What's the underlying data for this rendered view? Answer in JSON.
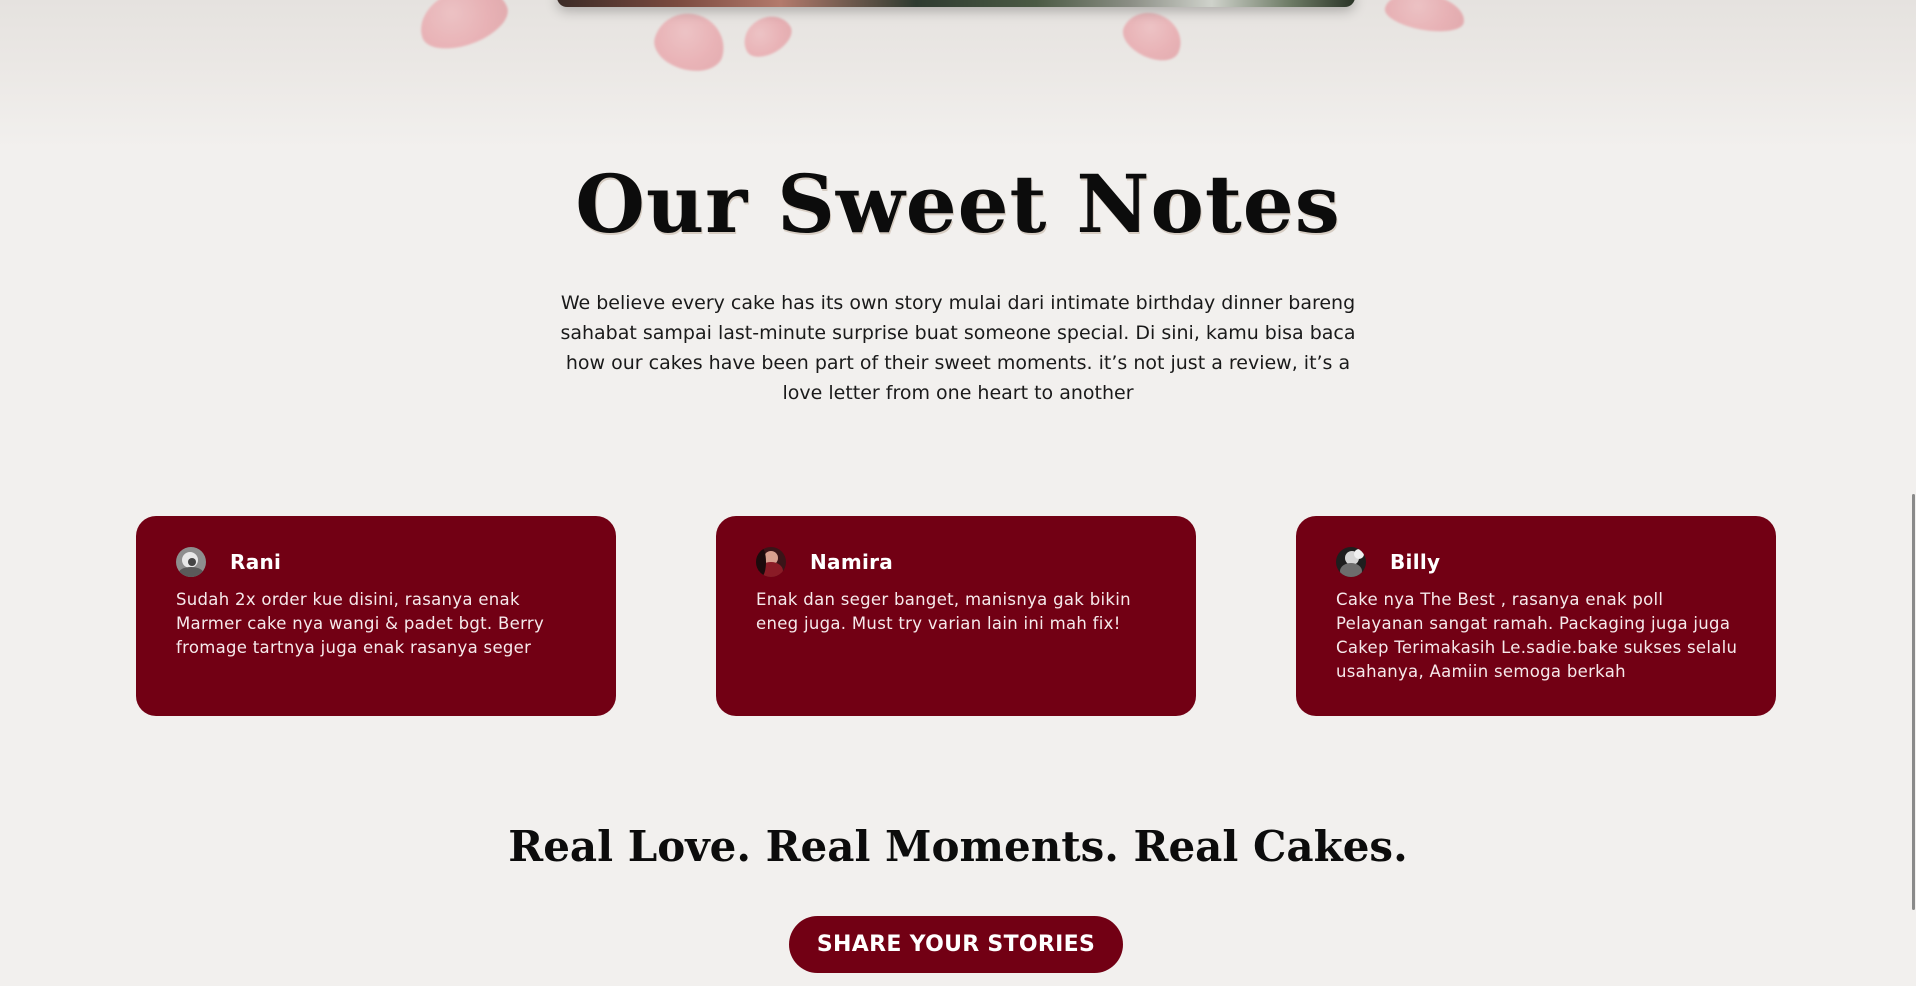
{
  "section": {
    "title": "Our Sweet Notes",
    "intro": "We believe every cake has its own story mulai dari intimate birthday dinner bareng sahabat sampai last-minute surprise buat someone special. Di sini, kamu bisa baca how our cakes have been part of their sweet moments. it’s not just a review, it’s a love letter from one heart to another"
  },
  "reviews": [
    {
      "name": "Rani",
      "text": "Sudah 2x order kue disini, rasanya enak Marmer cake nya wangi & padet bgt. Berry fromage tartnya juga enak rasanya seger"
    },
    {
      "name": "Namira",
      "text": "Enak dan seger banget, manisnya gak bikin eneg juga. Must try varian lain ini mah fix!"
    },
    {
      "name": "Billy",
      "text": "Cake nya The Best , rasanya enak poll Pelayanan sangat ramah. Packaging juga juga Cakep Terimakasih Le.sadie.bake sukses selalu usahanya, Aamiin semoga berkah"
    }
  ],
  "tagline": "Real Love. Real Moments. Real Cakes.",
  "cta": {
    "label": "SHARE YOUR STORIES"
  },
  "colors": {
    "accent": "#720014",
    "background": "#f2f0ee",
    "heading": "#0c0c0c"
  }
}
